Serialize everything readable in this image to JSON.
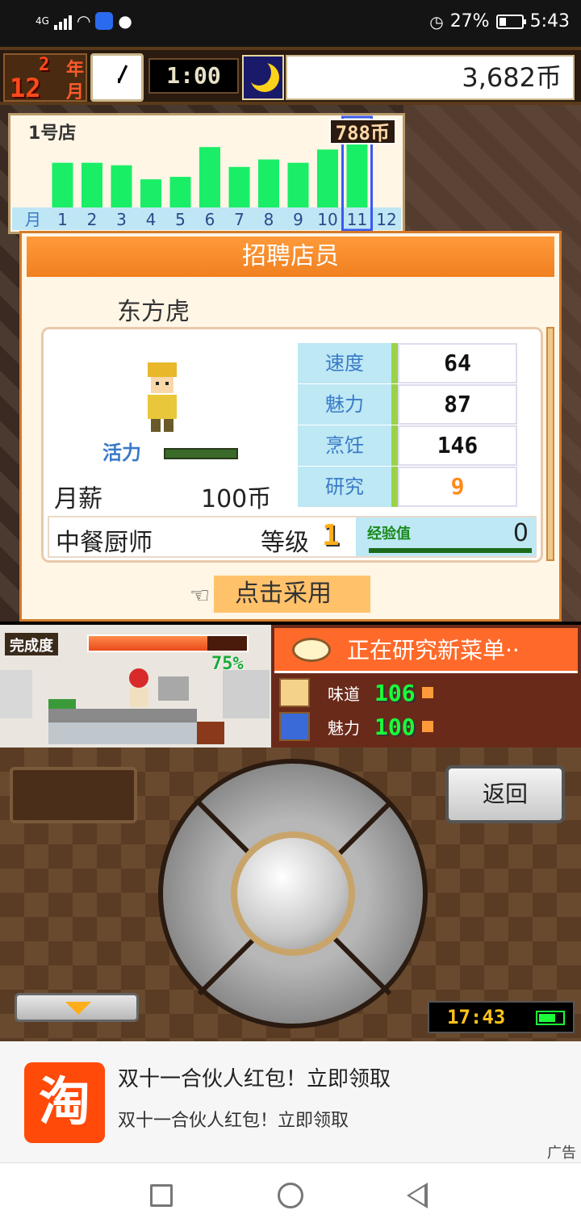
{
  "status_bar": {
    "network": "4G",
    "battery_pct": "27%",
    "time": "5:43",
    "battery_level": 0.27
  },
  "game_top": {
    "year": "2",
    "year_unit": "年",
    "month": "12",
    "month_unit": "月",
    "time": "1:00",
    "money": "3,682币"
  },
  "chart_data": {
    "type": "bar",
    "title": "1号店",
    "current_value_label": "788币",
    "xlabel": "月",
    "categories": [
      "1",
      "2",
      "3",
      "4",
      "5",
      "6",
      "7",
      "8",
      "9",
      "10",
      "11",
      "12"
    ],
    "values": [
      54,
      54,
      51,
      34,
      37,
      73,
      49,
      58,
      54,
      70,
      77,
      0
    ],
    "selected_category": "11",
    "colors": {
      "bar": "#1aee66",
      "selected": "#3a5aee"
    }
  },
  "recruit_dialog": {
    "title": "招聘店员",
    "staff_name": "东方虎",
    "vitality_label": "活力",
    "vitality_level": 1.0,
    "salary_label": "月薪",
    "salary_value": "100币",
    "stats": [
      {
        "label": "速度",
        "value": "64"
      },
      {
        "label": "魅力",
        "value": "87"
      },
      {
        "label": "烹饪",
        "value": "146"
      },
      {
        "label": "研究",
        "value": "9"
      }
    ],
    "job": "中餐厨师",
    "grade_label": "等级",
    "grade_value": "1",
    "exp_label": "经验值",
    "exp_value": "0",
    "adopt_label": "点击采用"
  },
  "kitchen": {
    "progress_label": "完成度",
    "progress_pct": "75%",
    "progress_level": 0.75
  },
  "research": {
    "title": "正在研究新菜单··",
    "rows": [
      {
        "label": "味道",
        "value": "106"
      },
      {
        "label": "魅力",
        "value": "100"
      }
    ]
  },
  "controller": {
    "back_label": "返回",
    "clock": "17:43"
  },
  "ad": {
    "logo_char": "淘",
    "title": "双十一合伙人红包！立即领取",
    "subtitle": "双十一合伙人红包！立即领取",
    "tag": "广告"
  }
}
